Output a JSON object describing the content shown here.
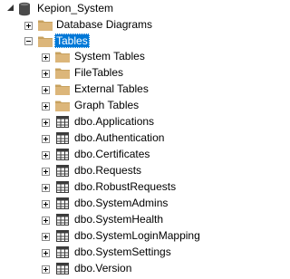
{
  "tree": {
    "database": {
      "label": "Kepion_System",
      "icon": "database-icon",
      "state": "expanded"
    },
    "diagrams": {
      "label": "Database Diagrams",
      "icon": "folder-icon"
    },
    "tables_folder": {
      "label": "Tables",
      "icon": "folder-icon",
      "state": "expanded",
      "selected": true
    },
    "subfolders": [
      {
        "label": "System Tables",
        "icon": "folder-icon",
        "state": "collapsed"
      },
      {
        "label": "FileTables",
        "icon": "folder-icon",
        "state": "collapsed"
      },
      {
        "label": "External Tables",
        "icon": "folder-icon",
        "state": "collapsed"
      },
      {
        "label": "Graph Tables",
        "icon": "folder-icon",
        "state": "collapsed"
      }
    ],
    "tables": [
      {
        "label": "dbo.Applications",
        "icon": "table-icon",
        "state": "collapsed"
      },
      {
        "label": "dbo.Authentication",
        "icon": "table-icon",
        "state": "collapsed"
      },
      {
        "label": "dbo.Certificates",
        "icon": "table-icon",
        "state": "collapsed"
      },
      {
        "label": "dbo.Requests",
        "icon": "table-icon",
        "state": "collapsed"
      },
      {
        "label": "dbo.RobustRequests",
        "icon": "table-icon",
        "state": "collapsed"
      },
      {
        "label": "dbo.SystemAdmins",
        "icon": "table-icon",
        "state": "collapsed"
      },
      {
        "label": "dbo.SystemHealth",
        "icon": "table-icon",
        "state": "collapsed"
      },
      {
        "label": "dbo.SystemLoginMapping",
        "icon": "table-icon",
        "state": "collapsed"
      },
      {
        "label": "dbo.SystemSettings",
        "icon": "table-icon",
        "state": "collapsed"
      },
      {
        "label": "dbo.Version",
        "icon": "table-icon",
        "state": "collapsed"
      }
    ]
  },
  "colors": {
    "selection_bg": "#0078d7",
    "selection_text": "#ffffff",
    "folder": "#dcb67a",
    "folder_dark": "#c7a15e",
    "table_icon": "#3c3c3c"
  }
}
